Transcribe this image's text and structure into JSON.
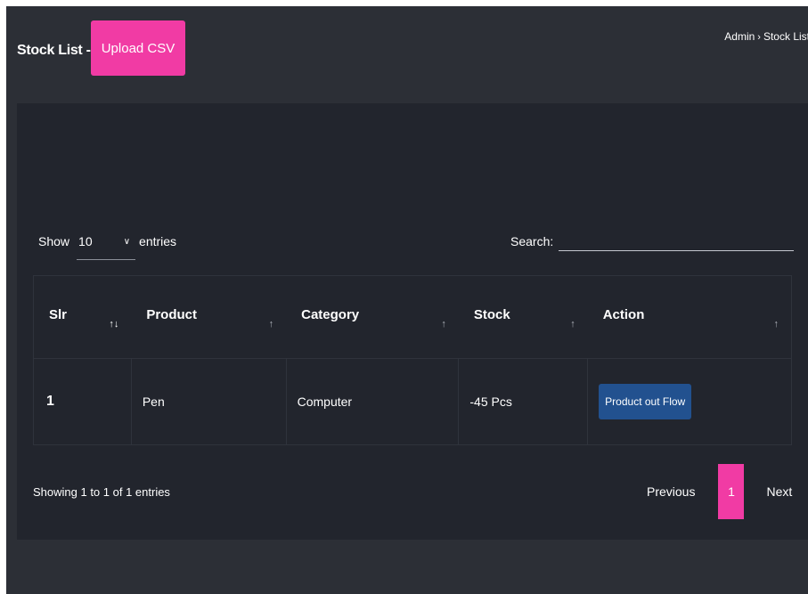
{
  "header": {
    "title": "Stock List -",
    "upload_label": "Upload CSV",
    "breadcrumb": [
      "Admin",
      "Stock List"
    ],
    "breadcrumb_separator": "›"
  },
  "controls": {
    "show_label": "Show",
    "length_value": "10",
    "entries_label": "entries",
    "search_label": "Search:",
    "search_value": ""
  },
  "table": {
    "columns": [
      "Slr",
      "Product",
      "Category",
      "Stock",
      "Action"
    ],
    "sort_icons": [
      "↑↓",
      "↑",
      "↑",
      "↑",
      "↑"
    ],
    "rows": [
      {
        "slr": "1",
        "product": "Pen",
        "category": "Computer",
        "stock": "-45 Pcs",
        "action": "Product out Flow"
      }
    ]
  },
  "footer": {
    "info": "Showing 1 to 1 of 1 entries",
    "previous": "Previous",
    "current_page": "1",
    "next": "Next"
  },
  "colors": {
    "accent_pink": "#f13ba4",
    "button_blue": "#22518f",
    "page_bg": "#2c2f36",
    "card_bg": "#22252d"
  }
}
